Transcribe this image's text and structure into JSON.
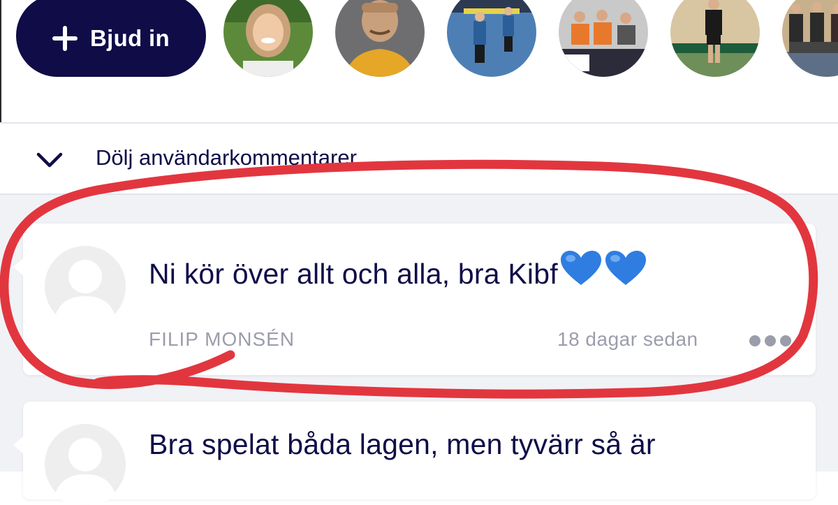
{
  "invite_button": {
    "label": "Bjud in",
    "icon": "plus-icon"
  },
  "members_row": {
    "avatars": [
      {
        "name": "avatar-woman-outdoors"
      },
      {
        "name": "avatar-man-yellow-shirt"
      },
      {
        "name": "avatar-floorball-players"
      },
      {
        "name": "avatar-spectators-orange"
      },
      {
        "name": "avatar-player-number-34"
      },
      {
        "name": "avatar-team-group"
      }
    ]
  },
  "toggle": {
    "label": "Dölj användarkommentarer",
    "icon": "chevron-down-icon"
  },
  "comments": [
    {
      "text": "Ni kör över allt och alla, bra Kibf",
      "emoji": "💙💙",
      "author": "FILIP MONSÉN",
      "time": "18 dagar sedan"
    },
    {
      "text": "Bra spelat båda lagen, men tyvärr så är",
      "author": "",
      "time": ""
    }
  ],
  "colors": {
    "navy": "#0f0c48",
    "muted": "#9b9dab",
    "annotation_red": "#e2363f",
    "heart_blue": "#2f7de1",
    "background": "#f1f2f6"
  }
}
